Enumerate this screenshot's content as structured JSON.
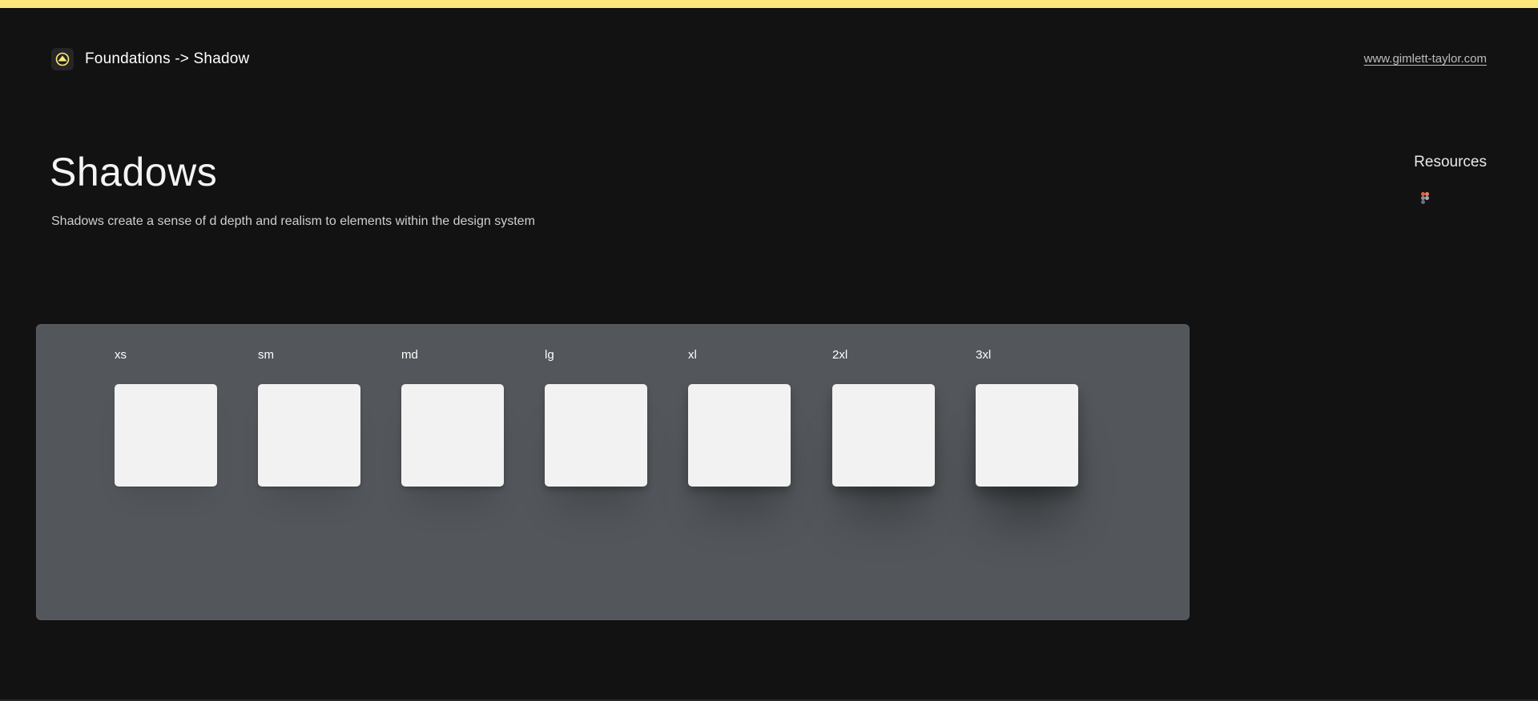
{
  "header": {
    "breadcrumb": "Foundations -> Shadow",
    "site_link": "www.gimlett-taylor.com"
  },
  "main": {
    "title": "Shadows",
    "description": "Shadows create a sense of d depth and realism to elements within the design system"
  },
  "resources": {
    "title": "Resources",
    "items": [
      {
        "icon": "figma-icon"
      }
    ]
  },
  "shadows": {
    "items": [
      {
        "label": "xs"
      },
      {
        "label": "sm"
      },
      {
        "label": "md"
      },
      {
        "label": "lg"
      },
      {
        "label": "xl"
      },
      {
        "label": "2xl"
      },
      {
        "label": "3xl"
      }
    ]
  },
  "colors": {
    "accent": "#fbe77a",
    "background": "#121212",
    "panel": "#53575b",
    "swatch": "#f2f2f2"
  }
}
